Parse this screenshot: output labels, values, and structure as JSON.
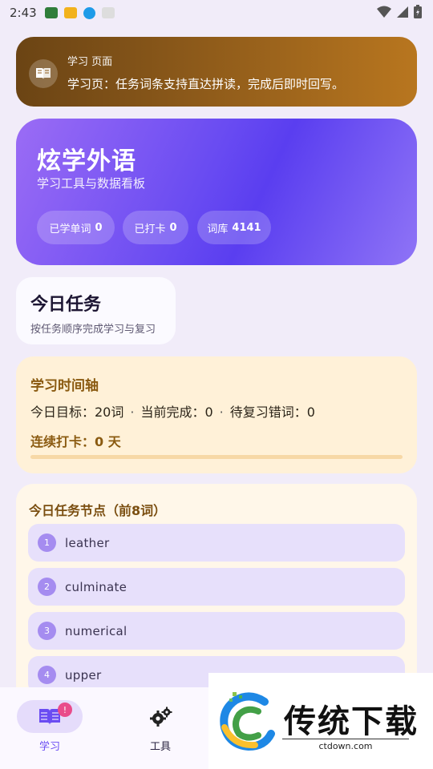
{
  "status_bar": {
    "time": "2:43"
  },
  "banner": {
    "title": "学习 页面",
    "text": "学习页：任务词条支持直达拼读，完成后即时回写。"
  },
  "hero": {
    "title": "炫学外语",
    "subtitle": "学习工具与数据看板",
    "chips": [
      {
        "label": "已学单词",
        "value": "0"
      },
      {
        "label": "已打卡",
        "value": "0"
      },
      {
        "label": "词库",
        "value": "4141"
      }
    ]
  },
  "today_task": {
    "title": "今日任务",
    "subtitle": "按任务顺序完成学习与复习"
  },
  "timeline": {
    "title": "学习时间轴",
    "goal": "今日目标：20词",
    "sep": "·",
    "completed": "当前完成：0",
    "review": "待复习错词：0",
    "streak": "连续打卡：0 天",
    "progress": 0
  },
  "nodes": {
    "title": "今日任务节点（前8词）",
    "items": [
      {
        "num": "1",
        "word": "leather"
      },
      {
        "num": "2",
        "word": "culminate"
      },
      {
        "num": "3",
        "word": "numerical"
      },
      {
        "num": "4",
        "word": "upper"
      }
    ]
  },
  "bottom_nav": {
    "items": [
      {
        "label": "学习",
        "icon": "book-icon",
        "active": true,
        "badge": "!"
      },
      {
        "label": "工具",
        "icon": "gears-icon",
        "active": false
      }
    ]
  },
  "watermark": {
    "text": "传统下载",
    "url": "ctdown.com"
  },
  "colors": {
    "accent": "#6a4cf2",
    "banner": "#8d5a1a",
    "timeline_bg": "#fff1d8"
  }
}
